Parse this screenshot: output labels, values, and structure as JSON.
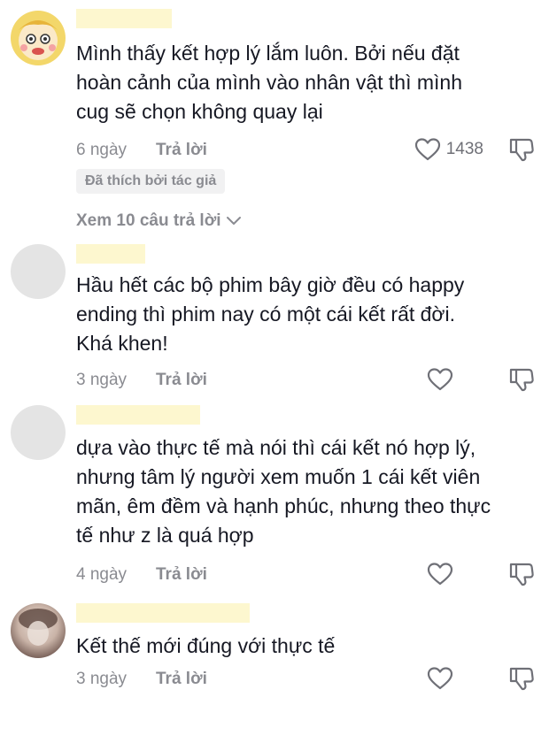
{
  "comments": [
    {
      "text_lines": [
        "Mình thấy kết hợp lý lắm luôn. Bởi nếu đặt",
        "hoàn cảnh của mình vào nhân vật thì mình",
        "cug sẽ chọn không quay lại"
      ],
      "time": "6 ngày",
      "reply_label": "Trả lời",
      "like_count": "1438",
      "badge": "Đã thích bởi tác giả",
      "view_replies": "Xem 10 câu trả lời",
      "avatar_icon": "cartoon-avatar"
    },
    {
      "text_lines": [
        "Hầu hết các bộ phim bây giờ đều có happy",
        "ending thì phim nay có một cái kết rất đời.",
        "Khá khen!"
      ],
      "time": "3 ngày",
      "reply_label": "Trả lời",
      "avatar_icon": "blank-avatar"
    },
    {
      "text_lines": [
        "dựa vào thực tế mà nói thì cái kết nó hợp lý,",
        "nhưng tâm lý người xem muốn 1 cái kết viên",
        "mãn, êm đềm và hạnh phúc, nhưng theo thực",
        "tế như z là quá hợp"
      ],
      "time": "4 ngày",
      "reply_label": "Trả lời",
      "avatar_icon": "blank-avatar"
    },
    {
      "text_lines": [
        "Kết thế mới đúng với thực tế"
      ],
      "time": "3 ngày",
      "reply_label": "Trả lời",
      "avatar_icon": "blurred-photo-avatar"
    }
  ],
  "colors": {
    "text": "#161823",
    "secondary": "#8a8b91",
    "name_highlight": "#fdf7cf",
    "badge_bg": "#f1f1f2"
  },
  "icons": [
    "heart-outline-icon",
    "thumbs-down-icon",
    "chevron-down-icon"
  ]
}
